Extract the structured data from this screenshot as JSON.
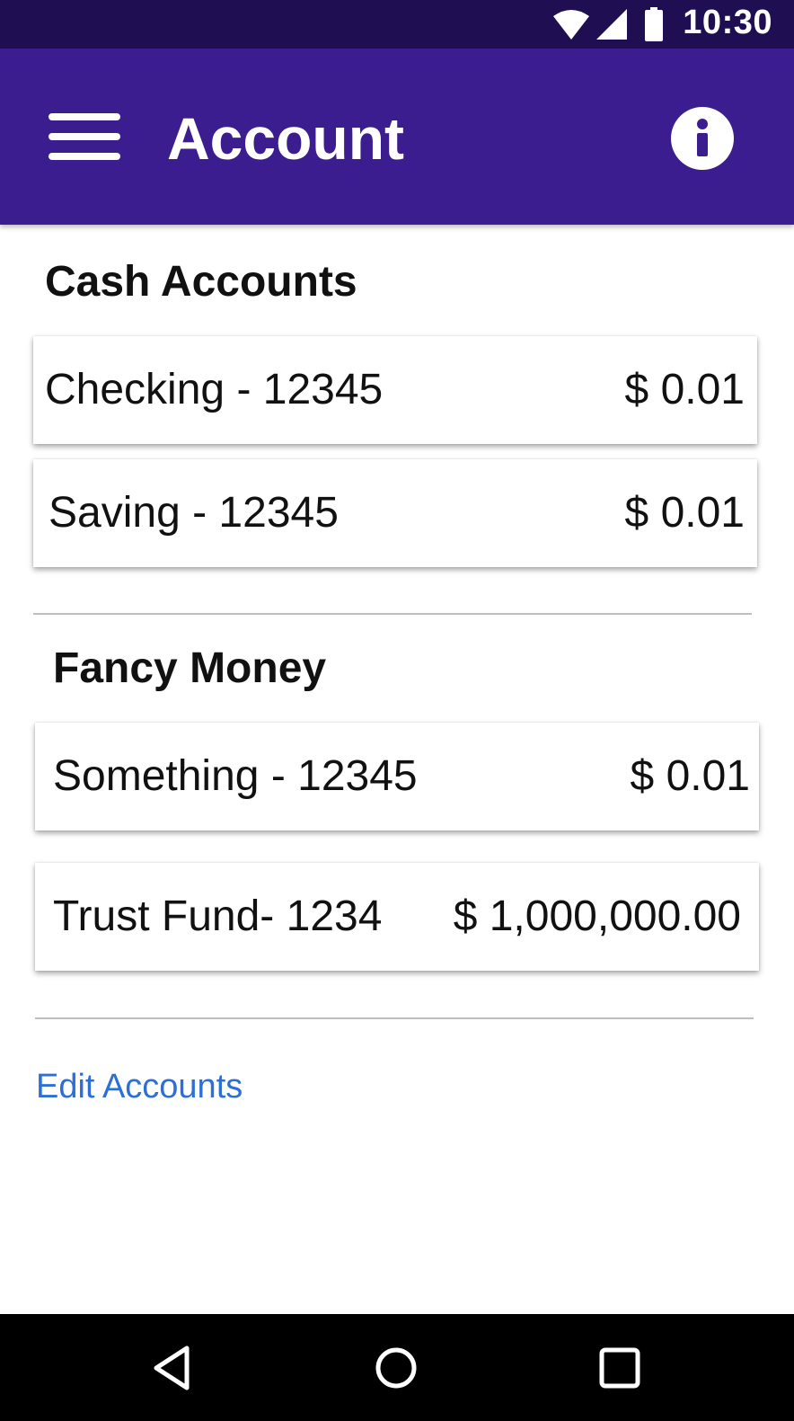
{
  "status_bar": {
    "time": "10:30",
    "icons": [
      "wifi-icon",
      "cell-signal-icon",
      "battery-icon"
    ]
  },
  "app_bar": {
    "title": "Account",
    "menu_icon": "hamburger-menu-icon",
    "info_icon": "info-icon"
  },
  "sections": [
    {
      "title": "Cash Accounts",
      "accounts": [
        {
          "name": "Checking - 12345",
          "amount": "$ 0.01"
        },
        {
          "name": "Saving - 12345",
          "amount": "$ 0.01"
        }
      ]
    },
    {
      "title": "Fancy Money",
      "accounts": [
        {
          "name": "Something - 12345",
          "amount": "$ 0.01"
        },
        {
          "name": "Trust Fund- 1234",
          "amount": "$ 1,000,000.00"
        }
      ]
    }
  ],
  "edit_accounts_label": "Edit Accounts",
  "nav_bar": {
    "icons": [
      "back-icon",
      "home-icon",
      "recents-icon"
    ]
  },
  "colors": {
    "status_bar": "#1f0f52",
    "app_bar": "#3c1d8f",
    "link": "#2d6fd6"
  }
}
